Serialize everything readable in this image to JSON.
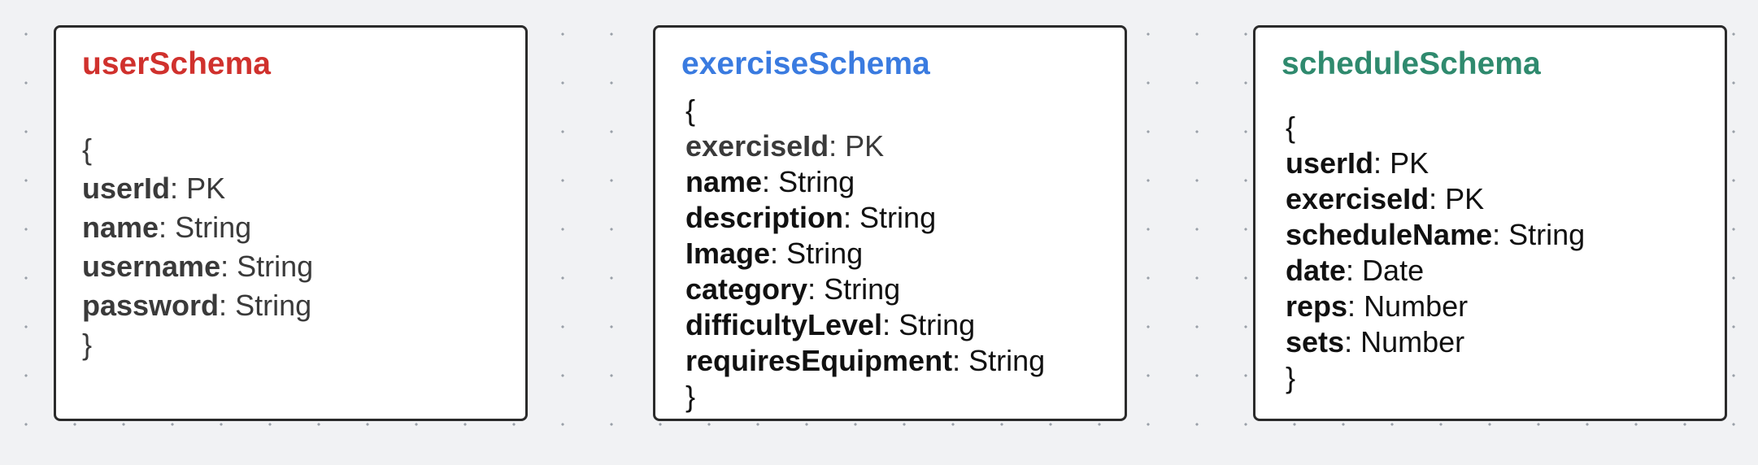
{
  "schemas": [
    {
      "title": "userSchema",
      "color": "#d0312d",
      "open": "{",
      "close": "}",
      "fields": [
        {
          "name": "userId",
          "type": "PK"
        },
        {
          "name": "name",
          "type": "String"
        },
        {
          "name": "username",
          "type": "String"
        },
        {
          "name": "password",
          "type": "String"
        }
      ]
    },
    {
      "title": "exerciseSchema",
      "color": "#3a7be0",
      "open": "{",
      "close": "}",
      "fields": [
        {
          "name": "exerciseId",
          "type": "PK"
        },
        {
          "name": "name",
          "type": "String"
        },
        {
          "name": "description",
          "type": "String"
        },
        {
          "name": "Image",
          "type": "String"
        },
        {
          "name": "category",
          "type": "String"
        },
        {
          "name": "difficultyLevel",
          "type": "String"
        },
        {
          "name": "requiresEquipment",
          "type": "String"
        }
      ]
    },
    {
      "title": "scheduleSchema",
      "color": "#2f8a6e",
      "open": "{",
      "close": "}",
      "fields": [
        {
          "name": "userId",
          "type": "PK"
        },
        {
          "name": "exerciseId",
          "type": "PK"
        },
        {
          "name": "scheduleName",
          "type": "String"
        },
        {
          "name": "date",
          "type": "Date"
        },
        {
          "name": "reps",
          "type": "Number"
        },
        {
          "name": "sets",
          "type": "Number"
        }
      ]
    }
  ]
}
